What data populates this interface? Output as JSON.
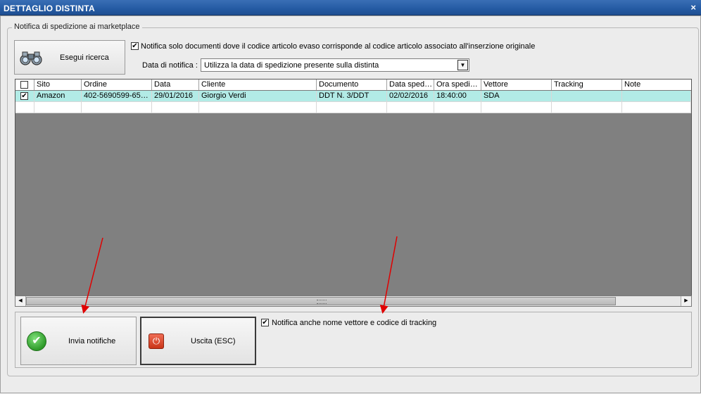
{
  "window": {
    "title": "DETTAGLIO DISTINTA",
    "close_glyph": "×"
  },
  "group": {
    "label": "Notifica di spedizione ai marketplace"
  },
  "search": {
    "label": "Esegui ricerca",
    "icon": "binoculars-icon"
  },
  "notify_option": {
    "checked": true,
    "label": "Notifica solo documenti dove il codice articolo evaso corrisponde al codice articolo associato all'inserzione originale"
  },
  "date_notify": {
    "label": "Data di notifica :",
    "value": "Utilizza la data di spedizione presente sulla distinta"
  },
  "grid": {
    "columns": [
      "",
      "Sito",
      "Ordine",
      "Data",
      "Cliente",
      "Documento",
      "Data sped…",
      "Ora spedi…",
      "Vettore",
      "Tracking",
      "Note"
    ],
    "rows": [
      {
        "checked": true,
        "sito": "Amazon",
        "ordine": "402-5690599-65…",
        "data": "29/01/2016",
        "cliente": "Giorgio Verdi",
        "documento": "DDT N. 3/DDT",
        "data_sped": "02/02/2016",
        "ora_sped": "18:40:00",
        "vettore": "SDA",
        "tracking": "",
        "note": ""
      }
    ]
  },
  "actions": {
    "invia": {
      "label": "Invia notifiche"
    },
    "uscita": {
      "label": "Uscita (ESC)"
    },
    "tracking_option": {
      "checked": true,
      "label": "Notifica anche nome vettore e codice di tracking"
    }
  },
  "colors": {
    "titlebar": "#245aa3",
    "selected_row": "#b2ebe6",
    "grid_bg": "#808080",
    "annotation_arrow": "#e00000"
  }
}
